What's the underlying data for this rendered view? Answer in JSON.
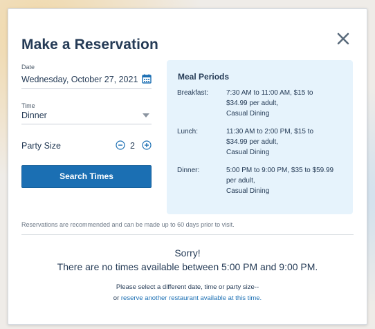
{
  "modal": {
    "title": "Make a Reservation",
    "close_icon": "close-icon"
  },
  "form": {
    "date_label": "Date",
    "date_value": "Wednesday, October 27, 2021",
    "calendar_icon": "calendar-icon",
    "time_label": "Time",
    "time_value": "Dinner",
    "party_label": "Party Size",
    "party_count": "2",
    "search_button": "Search Times"
  },
  "meal_periods": {
    "title": "Meal Periods",
    "items": [
      {
        "name": "Breakfast:",
        "line1": "7:30 AM to 11:00 AM, $15 to",
        "line2": "$34.99 per adult,",
        "line3": "Casual Dining"
      },
      {
        "name": "Lunch:",
        "line1": "11:30 AM to 2:00 PM, $15 to",
        "line2": "$34.99 per adult,",
        "line3": "Casual Dining"
      },
      {
        "name": "Dinner:",
        "line1": "5:00 PM to 9:00 PM, $35 to $59.99",
        "line2": "per adult,",
        "line3": "Casual Dining"
      }
    ]
  },
  "note": "Reservations are recommended and can be made up to 60 days prior to visit.",
  "results": {
    "sorry": "Sorry!",
    "message": "There are no times available between 5:00 PM and 9:00 PM.",
    "select_different": "Please select a different date, time or party size--",
    "or_prefix": "or ",
    "link_text": "reserve another restaurant available at this time."
  },
  "colors": {
    "primary": "#1b6fb3",
    "text": "#253b56",
    "panel_bg": "#e6f3fc"
  }
}
